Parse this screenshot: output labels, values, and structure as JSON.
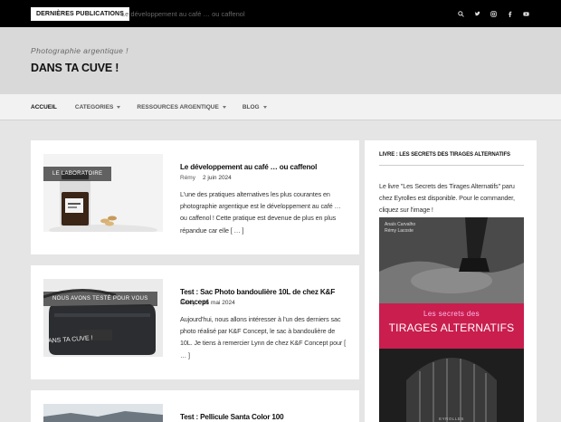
{
  "topbar": {
    "latest_label": "Dernières publications",
    "ticker_text": "Le développement au café … ou caffenol",
    "social": [
      "search-icon",
      "twitter-icon",
      "instagram-icon",
      "facebook-icon",
      "youtube-icon"
    ]
  },
  "header": {
    "tagline": "Photographie argentique !",
    "site_title": "DANS TA CUVE !"
  },
  "nav": {
    "items": [
      {
        "label": "Accueil",
        "dropdown": false,
        "active": true
      },
      {
        "label": "Categories",
        "dropdown": true
      },
      {
        "label": "Ressources argentique",
        "dropdown": true
      },
      {
        "label": "Blog",
        "dropdown": true
      }
    ]
  },
  "posts": [
    {
      "category": "Le laboratoire",
      "title": "Le développement au café … ou caffenol",
      "author": "Rémy",
      "date": "2 juin 2024",
      "excerpt": "L'une des pratiques alternatives les plus courantes en photographie argentique est le développement au café … ou caffenol ! Cette pratique est devenue de plus en plus répandue car elle [ … ]"
    },
    {
      "category": "Nous avons testé pour vous",
      "title": "Test : Sac Photo bandoulière 10L de chez K&F Concept",
      "author": "Rémy",
      "date": "15 mai 2024",
      "excerpt": "Aujourd'hui, nous allons intéresser à l'un des derniers sac photo réalisé par K&F Concept, le sac à bandoulière de 10L. Je tiens à remercier Lynn de chez K&F Concept pour [ … ]",
      "image_text": "DANS TA CUVE !"
    },
    {
      "title": "Test : Pellicule Santa Color 100"
    }
  ],
  "sidebar": {
    "widget_title": "Livre : Les secrets des tirages alternatifs",
    "text": "Le livre \"Les Secrets des Tirages Alternatifs\" paru chez Eyrolles est disponible. Pour le commander, cliquez sur l'image !",
    "book": {
      "authors": "Anaïs Carvalho\nRémy Lacoste",
      "line1": "Les secrets des",
      "line2": "TIRAGES ALTERNATIFS",
      "publisher": "EYROLLES"
    }
  },
  "colors": {
    "topbar_bg": "#000000",
    "header_bg": "#d9d9d9",
    "page_bg": "#e5e5e5",
    "book_band": "#c91e4e"
  }
}
